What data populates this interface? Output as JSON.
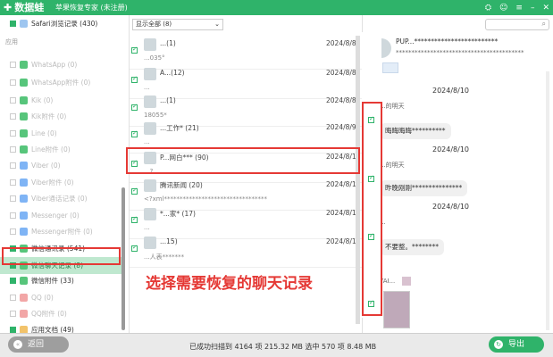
{
  "app": {
    "logo": "数据蛙",
    "title": "苹果恢复专家 (未注册)",
    "window_controls": [
      "gift-icon",
      "user-icon",
      "menu-icon",
      "minimize-icon",
      "close-icon"
    ]
  },
  "sidebar": {
    "top_item": "Safari浏览记录 (430)",
    "section": "应用",
    "items": [
      {
        "label": "WhatsApp (0)",
        "icon": "whatsapp-icon",
        "active": false
      },
      {
        "label": "WhatsApp附件 (0)",
        "icon": "whatsapp-attach-icon",
        "active": false
      },
      {
        "label": "Kik (0)",
        "icon": "kik-icon",
        "active": false
      },
      {
        "label": "Kik附件 (0)",
        "icon": "kik-attach-icon",
        "active": false
      },
      {
        "label": "Line (0)",
        "icon": "line-icon",
        "active": false
      },
      {
        "label": "Line附件 (0)",
        "icon": "line-attach-icon",
        "active": false
      },
      {
        "label": "Viber (0)",
        "icon": "viber-icon",
        "active": false
      },
      {
        "label": "Viber附件 (0)",
        "icon": "viber-attach-icon",
        "active": false
      },
      {
        "label": "Viber通话记录 (0)",
        "icon": "viber-call-icon",
        "active": false
      },
      {
        "label": "Messenger (0)",
        "icon": "messenger-icon",
        "active": false
      },
      {
        "label": "Messenger附件 (0)",
        "icon": "messenger-attach-icon",
        "active": false
      },
      {
        "label": "微信通讯录 (541)",
        "icon": "wechat-contacts-icon",
        "active": true
      },
      {
        "label": "微信聊天记录 (8)",
        "icon": "wechat-chat-icon",
        "active": true,
        "selected": true
      },
      {
        "label": "微信附件 (33)",
        "icon": "wechat-attach-icon",
        "active": true
      },
      {
        "label": "QQ (0)",
        "icon": "qq-icon",
        "active": false
      },
      {
        "label": "QQ附件 (0)",
        "icon": "qq-attach-icon",
        "active": false
      },
      {
        "label": "应用文档 (49)",
        "icon": "app-doc-icon",
        "active": true
      }
    ]
  },
  "filter": {
    "value": "显示全部 (8)"
  },
  "conversations": [
    {
      "name": "...(1)",
      "date": "2024/8/8",
      "preview": "...035°"
    },
    {
      "name": "A...(12)",
      "date": "2024/8/8",
      "preview": "..."
    },
    {
      "name": "...(1)",
      "date": "2024/8/8",
      "preview": "18055*"
    },
    {
      "name": "...工作* (21)",
      "date": "2024/8/9",
      "preview": "..."
    },
    {
      "name": "P...网白*** (90)",
      "date": "2024/8/10",
      "preview": "...?"
    },
    {
      "name": "腾讯新闻 (20)",
      "date": "2024/8/12",
      "preview": "<?xml*********************************"
    },
    {
      "name": "*...家* (17)",
      "date": "2024/8/12",
      "preview": "..."
    },
    {
      "name": "...15)",
      "date": "2024/8/12",
      "preview": "...人表*******"
    }
  ],
  "annotation": "选择需要恢复的聊天记录",
  "chat": {
    "header_title": "PUP...*************************",
    "header_sub": "*****************************************",
    "messages": [
      {
        "date": "2024/8/10",
        "sender": "...的明天",
        "text": "晦晦晦晦**********"
      },
      {
        "date": "2024/8/10",
        "sender": "...的明天",
        "text": "昨晚刚刚***************"
      },
      {
        "date": "2024/8/10",
        "sender": "...",
        "text": "不要整。********"
      },
      {
        "date": "",
        "sender": "YAI...",
        "text": ""
      }
    ]
  },
  "footer": {
    "back_label": "返回",
    "status": "已成功扫描到 4164 项 215.32 MB    选中 570 项 8.48 MB",
    "export_label": "导出"
  },
  "colors": {
    "brand": "#2fb36a",
    "highlight": "#e53935"
  }
}
